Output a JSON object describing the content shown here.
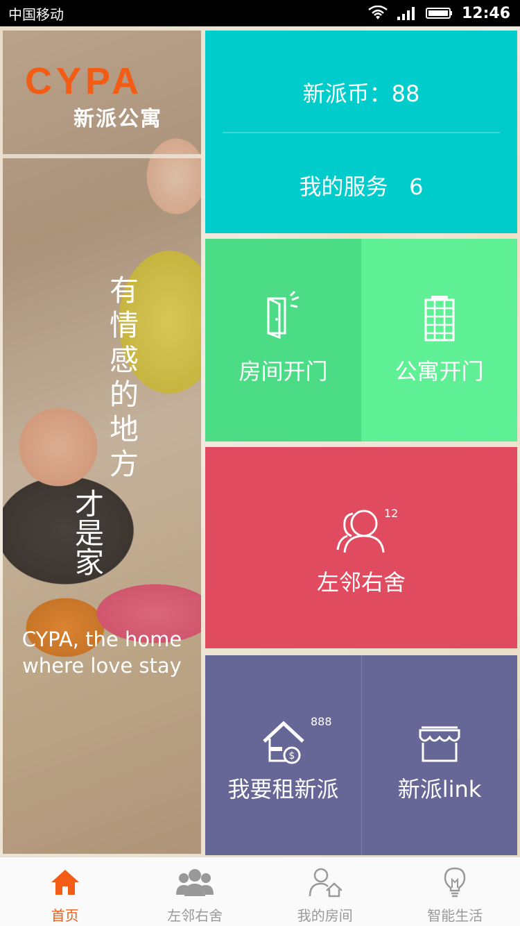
{
  "status_bar": {
    "carrier": "中国移动",
    "time": "12:46"
  },
  "brand": {
    "logo": "CYPA",
    "subtitle": "新派公寓"
  },
  "slogan": {
    "line1": "有情感的地方",
    "line2": "才是家",
    "english_line1": "CYPA, the home",
    "english_line2": "where love stay"
  },
  "tiles": {
    "coins_label": "新派币：88",
    "services_label": "我的服务   6",
    "room_door": "房间开门",
    "apartment_door": "公寓开门",
    "neighbors": "左邻右舍",
    "neighbors_badge": "12",
    "rent": "我要租新派",
    "rent_badge": "888",
    "link": "新派link"
  },
  "colors": {
    "coins": "#00cccc",
    "room_door": "#4bdc85",
    "apartment_door": "#5fef95",
    "neighbors": "#e14b5f",
    "rent": "#666797",
    "accent": "#f25c15"
  },
  "bottom_nav": {
    "items": [
      {
        "label": "首页",
        "icon": "home-icon",
        "active": true
      },
      {
        "label": "左邻右舍",
        "icon": "people-icon",
        "active": false
      },
      {
        "label": "我的房间",
        "icon": "user-house-icon",
        "active": false
      },
      {
        "label": "智能生活",
        "icon": "lightbulb-icon",
        "active": false
      }
    ]
  }
}
